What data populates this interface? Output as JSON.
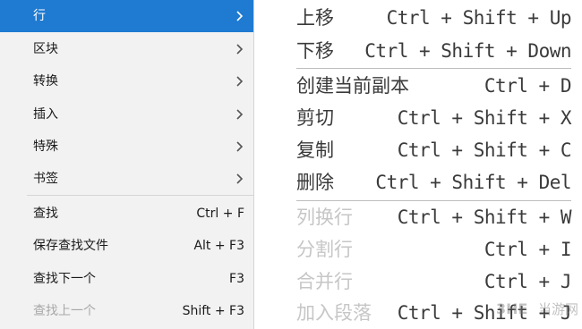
{
  "main_menu": {
    "items": [
      {
        "label": "行",
        "has_submenu": true,
        "state": "active"
      },
      {
        "label": "区块",
        "has_submenu": true
      },
      {
        "label": "转换",
        "has_submenu": true
      },
      {
        "label": "插入",
        "has_submenu": true
      },
      {
        "label": "特殊",
        "has_submenu": true
      },
      {
        "label": "书签",
        "has_submenu": true
      },
      {
        "label": "查找",
        "shortcut": "Ctrl + F"
      },
      {
        "label": "保存查找文件",
        "shortcut": "Alt + F3"
      },
      {
        "label": "查找下一个",
        "shortcut": "F3"
      },
      {
        "label": "查找上一个",
        "shortcut": "Shift + F3",
        "state": "disabled"
      }
    ]
  },
  "line_submenu": {
    "items": [
      {
        "label": "上移",
        "shortcut": "Ctrl + Shift + Up"
      },
      {
        "label": "下移",
        "shortcut": "Ctrl + Shift + Down"
      },
      {
        "label": "创建当前副本",
        "shortcut": "Ctrl + D"
      },
      {
        "label": "剪切",
        "shortcut": "Ctrl + Shift + X"
      },
      {
        "label": "复制",
        "shortcut": "Ctrl + Shift + C"
      },
      {
        "label": "删除",
        "shortcut": "Ctrl + Shift + Del"
      },
      {
        "label": "列换行",
        "shortcut": "Ctrl + Shift + W",
        "state": "disabled"
      },
      {
        "label": "分割行",
        "shortcut": "Ctrl + I",
        "state": "disabled"
      },
      {
        "label": "合并行",
        "shortcut": "Ctrl + J",
        "state": "disabled"
      },
      {
        "label": "加入段落",
        "shortcut": "Ctrl + Shift + J",
        "state": "disabled"
      }
    ]
  },
  "watermark": {
    "text": "当游网"
  },
  "colors": {
    "active_bg": "#1f7ad1",
    "menu_bg": "#f2f2f2",
    "disabled_text": "#a8a8a8"
  }
}
